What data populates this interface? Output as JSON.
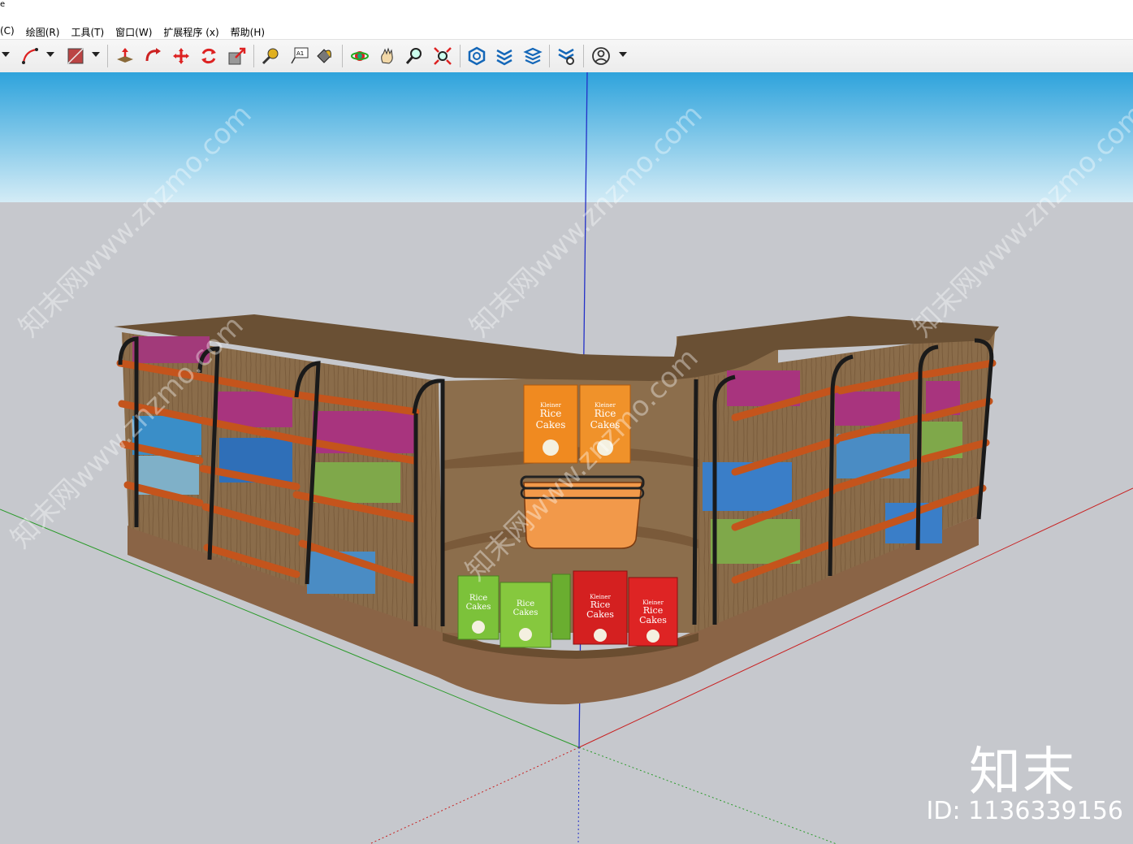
{
  "menubar": {
    "leading_mark": "e",
    "items": [
      "(C)",
      "绘图(R)",
      "工具(T)",
      "窗口(W)",
      "扩展程序 (x)",
      "帮助(H)"
    ]
  },
  "toolbar": {
    "icons": [
      "arc-tool-icon",
      "shape-tool-icon",
      "push-pull-icon",
      "follow-me-icon",
      "move-icon",
      "rotate-icon",
      "scale-icon",
      "tape-measure-icon",
      "text-label-icon",
      "paint-bucket-icon",
      "orbit-icon",
      "pan-icon",
      "zoom-icon",
      "zoom-extents-icon",
      "warehouse-icon",
      "extension-warehouse-icon",
      "layout-icon",
      "extension-manager-icon",
      "account-icon"
    ]
  },
  "scene": {
    "product_brand": "Kleiner",
    "product_line1": "Rice",
    "product_line2": "Cakes",
    "watermark_text": "知末网www.znzmo.com",
    "colors": {
      "sky_top": "#2ea3dc",
      "sky_bottom": "#d4ecf6",
      "ground": "#c6c8cd",
      "wood": "#8a6c4a",
      "wood_dark": "#6a5034",
      "rail": "#c4541c",
      "metal": "#1a1a1a"
    }
  },
  "overlay": {
    "brand": "知末",
    "id_label": "ID: 1136339156"
  }
}
